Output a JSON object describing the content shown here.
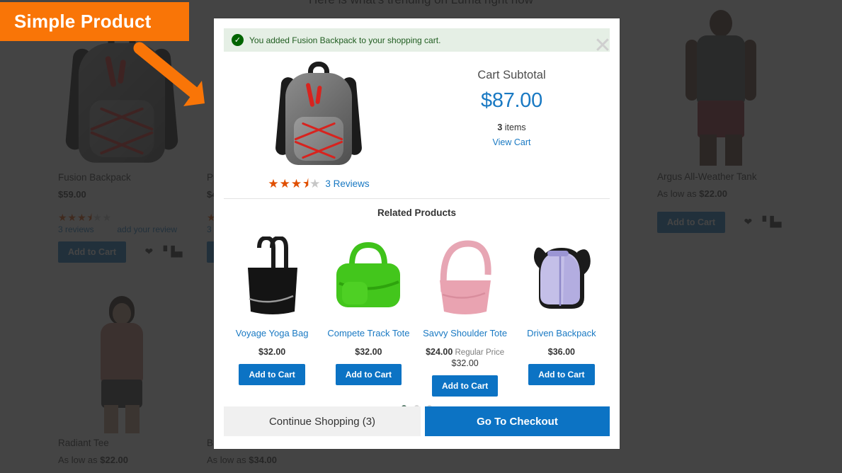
{
  "background": {
    "heading": "Here is what's trending on Luma right now",
    "products": [
      {
        "name": "Fusion Backpack",
        "price": "$59.00",
        "price_prefix": "",
        "reviews_label": "3  reviews",
        "add_review_label": "add your review",
        "add_to_cart_label": "Add to Cart",
        "rating_stars": 3.5,
        "wishlist_icon": "heart-icon",
        "compare_icon": "compare-icon"
      },
      {
        "name": "Pu",
        "price": "$4",
        "price_prefix": "",
        "reviews_label": "3",
        "add_review_label": "",
        "add_to_cart_label": "",
        "rating_stars": 3.5
      },
      {
        "name": "Argus All-Weather Tank",
        "price": "$22.00",
        "price_prefix": "As low as ",
        "add_to_cart_label": "Add to Cart",
        "wishlist_icon": "heart-icon",
        "compare_icon": "compare-icon"
      },
      {
        "name": "Radiant Tee",
        "price": "$22.00",
        "price_prefix": "As low as "
      },
      {
        "name": "Br",
        "price": "$34.00",
        "price_prefix": "As low as "
      }
    ]
  },
  "banner": {
    "label": "Simple Product",
    "color": "#f97507",
    "arrow_icon": "arrow-down-right-icon"
  },
  "modal": {
    "close_icon": "close-icon",
    "success": {
      "icon": "check-circle-icon",
      "message": "You added Fusion Backpack to your shopping cart."
    },
    "product": {
      "image_alt": "fusion-backpack-image",
      "rating_stars": 3.5,
      "reviews_label": "3 Reviews"
    },
    "cart": {
      "subtotal_label": "Cart Subtotal",
      "subtotal_amount": "$87.00",
      "items_count": "3",
      "items_label": " items",
      "view_cart_label": "View Cart"
    },
    "related": {
      "title": "Related Products",
      "items": [
        {
          "name": "Voyage Yoga Bag",
          "price": "$32.00",
          "regular_price_label": "",
          "old_price": "",
          "add_to_cart_label": "Add to Cart",
          "image_alt": "black-tote-bag-image"
        },
        {
          "name": "Compete Track Tote",
          "price": "$32.00",
          "regular_price_label": "",
          "old_price": "",
          "add_to_cart_label": "Add to Cart",
          "image_alt": "green-duffel-bag-image"
        },
        {
          "name": "Savvy Shoulder Tote",
          "price": "$24.00",
          "regular_price_label": " Regular Price",
          "old_price": "$32.00",
          "add_to_cart_label": "Add to Cart",
          "image_alt": "pink-shoulder-bag-image"
        },
        {
          "name": "Driven Backpack",
          "price": "$36.00",
          "regular_price_label": "",
          "old_price": "",
          "add_to_cart_label": "Add to Cart",
          "image_alt": "lavender-backpack-image"
        }
      ],
      "carousel_dots": 3,
      "active_dot": 0
    },
    "footer": {
      "continue_label": "Continue Shopping (3)",
      "checkout_label": "Go To Checkout"
    }
  },
  "colors": {
    "accent_blue": "#1979c3",
    "button_blue": "#0c73c4",
    "banner_orange": "#f97507",
    "star_orange": "#e04f00",
    "success_green": "#006400"
  }
}
